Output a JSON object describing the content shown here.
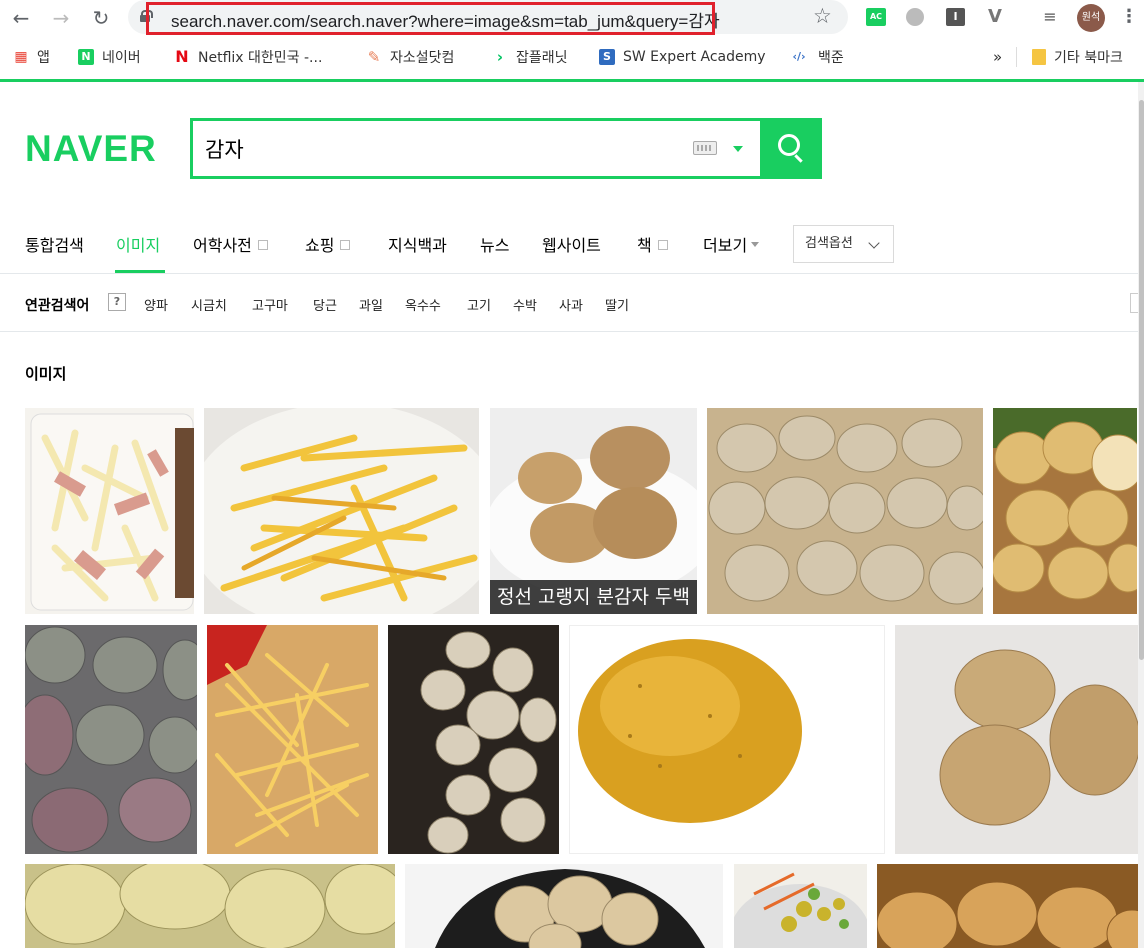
{
  "browser": {
    "url": "search.naver.com/search.naver?where=image&sm=tab_jum&query=감자",
    "extension_badge": "AC",
    "profile_name": "원석"
  },
  "bookmarks": [
    {
      "label": "앱",
      "icon": "apps-grid-icon",
      "color": "#4285f4"
    },
    {
      "label": "네이버",
      "icon": "naver-n-icon",
      "color": "#19ce60"
    },
    {
      "label": "Netflix 대한민국 -...",
      "icon": "netflix-n-icon",
      "color": "#e50914"
    },
    {
      "label": "자소설닷컴",
      "icon": "pencil-icon",
      "color": "#e8805a"
    },
    {
      "label": "잡플래닛",
      "icon": "chevron-icon",
      "color": "#00c362"
    },
    {
      "label": "SW Expert Academy",
      "icon": "s-icon",
      "color": "#2f6bbf"
    },
    {
      "label": "백준",
      "icon": "code-icon",
      "color": "#3b73c8"
    },
    {
      "label": "»",
      "icon": "",
      "color": ""
    },
    {
      "label": "기타 북마크",
      "icon": "folder-icon",
      "color": "#f5c542"
    }
  ],
  "naver": {
    "logo": "NAVER",
    "query": "감자",
    "brand_color": "#19ce60"
  },
  "tabs": [
    {
      "label": "통합검색",
      "active": false,
      "box": false
    },
    {
      "label": "이미지",
      "active": true,
      "box": false
    },
    {
      "label": "어학사전",
      "active": false,
      "box": true
    },
    {
      "label": "쇼핑",
      "active": false,
      "box": true
    },
    {
      "label": "지식백과",
      "active": false,
      "box": false
    },
    {
      "label": "뉴스",
      "active": false,
      "box": false
    },
    {
      "label": "웹사이트",
      "active": false,
      "box": false
    },
    {
      "label": "책",
      "active": false,
      "box": true
    },
    {
      "label": "더보기",
      "active": false,
      "box": false
    }
  ],
  "search_options": "검색옵션",
  "related": {
    "title": "연관검색어",
    "help": "?",
    "items": [
      "양파",
      "시금치",
      "고구마",
      "당근",
      "과일",
      "옥수수",
      "고기",
      "수박",
      "사과",
      "딸기"
    ]
  },
  "section_title": "이미지",
  "images": [
    {
      "subject": "potato salad with ham",
      "caption": ""
    },
    {
      "subject": "french fries",
      "caption": ""
    },
    {
      "subject": "potatoes on plate",
      "caption": "정선 고랭지 분감자 두백"
    },
    {
      "subject": "pile of potatoes",
      "caption": ""
    },
    {
      "subject": "potatoes in basket",
      "caption": ""
    },
    {
      "subject": "purple potatoes",
      "caption": ""
    },
    {
      "subject": "french fries in bag",
      "caption": ""
    },
    {
      "subject": "potatoes dark background",
      "caption": ""
    },
    {
      "subject": "single yellow potato",
      "caption": ""
    },
    {
      "subject": "three potatoes",
      "caption": ""
    },
    {
      "subject": "potatoes close-up",
      "caption": ""
    },
    {
      "subject": "potatoes in bag",
      "caption": ""
    },
    {
      "subject": "salad",
      "caption": ""
    },
    {
      "subject": "potatoes row",
      "caption": ""
    }
  ]
}
